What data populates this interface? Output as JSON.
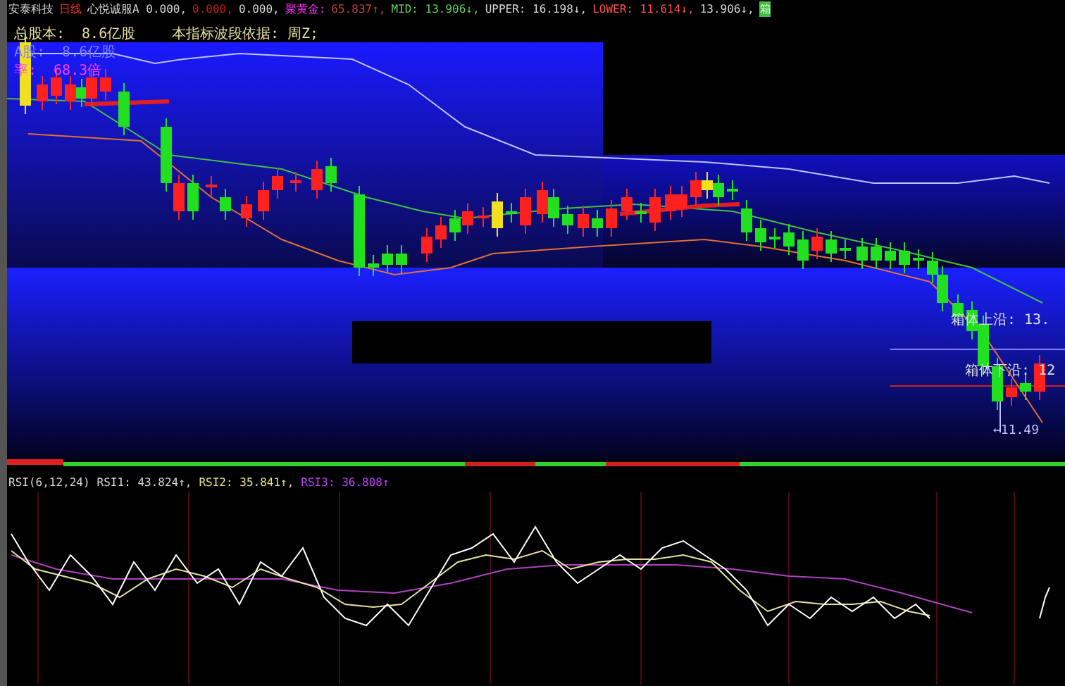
{
  "header": {
    "items": [
      {
        "text": "安泰科技",
        "color": "#d8d8d8"
      },
      {
        "text": "日线",
        "color": "#ff3030"
      },
      {
        "text": "心悦诚服A 0.000,",
        "color": "#d8d8d8"
      },
      {
        "text": "0.000,",
        "color": "#c02020"
      },
      {
        "text": "0.000,",
        "color": "#d8d8d8"
      },
      {
        "text": "聚黄金:",
        "color": "#ff30ff"
      },
      {
        "text": "65.837↑,",
        "color": "#c04040"
      },
      {
        "text": "MID: 13.906↓,",
        "color": "#60d060"
      },
      {
        "text": "UPPER: 16.198↓,",
        "color": "#d8d8d8"
      },
      {
        "text": "LOWER: 11.614↓,",
        "color": "#ff5050"
      },
      {
        "text": "13.906↓,",
        "color": "#d8d8d8"
      },
      {
        "text": "箱",
        "color": "#40c040"
      }
    ]
  },
  "stats": [
    {
      "label": "总股本:",
      "value": "8.6亿股",
      "color": "#e8e0a0"
    },
    {
      "label": "A股:",
      "value": "8.6亿股",
      "color": "#8080ff"
    },
    {
      "label": "率:",
      "value": "68.3倍",
      "color": "#ff40ff"
    }
  ],
  "note": "本指标波段依据: 周Z;",
  "box_labels": [
    {
      "text": "箱体上沿: 13.",
      "kind": "upper"
    },
    {
      "text": "箱体下沿: 12",
      "kind": "lower"
    }
  ],
  "low_marker": "←11.49",
  "rsi": {
    "items": [
      {
        "text": "RSI(6,12,24)",
        "color": "#d8d8d8"
      },
      {
        "text": "RSI1: 43.824↑,",
        "color": "#d8d8d8"
      },
      {
        "text": "RSI2: 35.841↑,",
        "color": "#e8e080"
      },
      {
        "text": "RSI3: 36.808↑",
        "color": "#c040ff"
      }
    ]
  }
}
